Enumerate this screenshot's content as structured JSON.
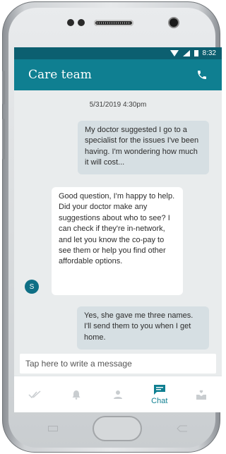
{
  "status_bar": {
    "time": "8:32"
  },
  "app_bar": {
    "title": "Care team",
    "call_icon": "phone-icon"
  },
  "chat": {
    "timestamp": "5/31/2019 4:30pm",
    "messages": [
      {
        "from": "user",
        "text": "My doctor suggested I go to a specialist for the issues I've been having. I'm wondering how much it will cost..."
      },
      {
        "from": "care",
        "avatar": "S",
        "text": "Good question, I'm happy to help. Did your doctor make any suggestions about who to see? I can check if they're in-network, and let you know the co-pay to see them or help you find other affordable options."
      },
      {
        "from": "user",
        "text": "Yes, she gave me three names. I'll send them to you when I get home."
      }
    ]
  },
  "composer": {
    "placeholder": "Tap here to write a message"
  },
  "tabs": [
    {
      "icon": "double-check-icon",
      "label": ""
    },
    {
      "icon": "bell-icon",
      "label": ""
    },
    {
      "icon": "person-icon",
      "label": ""
    },
    {
      "icon": "chat-icon",
      "label": "Chat",
      "active": true
    },
    {
      "icon": "hand-heart-icon",
      "label": ""
    }
  ],
  "colors": {
    "primary": "#0f7f91",
    "status_bar": "#0c5f70",
    "chat_bg": "#e9eced",
    "outgoing_bubble": "#d6dfe3"
  }
}
